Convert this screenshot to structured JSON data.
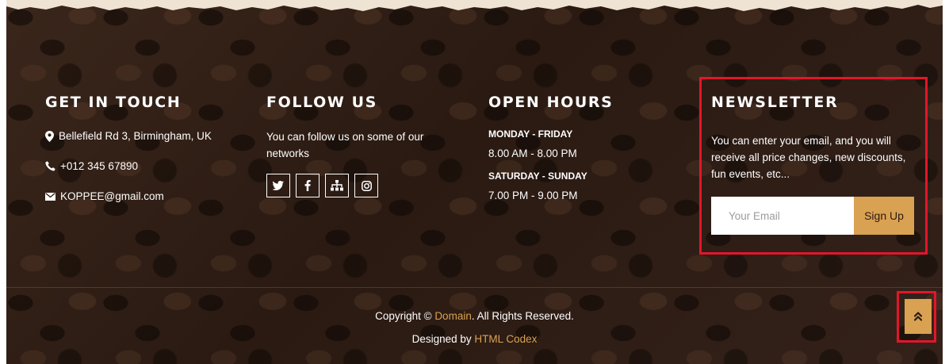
{
  "contact": {
    "title": "GET IN TOUCH",
    "address": "Bellefield Rd 3, Birmingham, UK",
    "phone": "+012 345 67890",
    "email": "KOPPEE@gmail.com",
    "icons": [
      "map-marker-icon",
      "phone-icon",
      "envelope-icon"
    ]
  },
  "follow": {
    "title": "FOLLOW US",
    "text": "You can follow us on some of our networks",
    "socials": [
      "twitter-icon",
      "facebook-icon",
      "sitemap-icon",
      "instagram-icon"
    ]
  },
  "hours": {
    "title": "OPEN HOURS",
    "weekday_label": "MONDAY - FRIDAY",
    "weekday_time": "8.00 AM - 8.00 PM",
    "weekend_label": "SATURDAY - SUNDAY",
    "weekend_time": "7.00 PM - 9.00 PM"
  },
  "newsletter": {
    "title": "NEWSLETTER",
    "text": "You can enter your email, and you will receive all price changes, new discounts, fun events, etc...",
    "placeholder": "Your Email",
    "button": "Sign Up"
  },
  "footer": {
    "copyright_prefix": "Copyright © ",
    "domain_link": "Domain",
    "copyright_suffix": ". All Rights Reserved.",
    "designed_prefix": "Designed by ",
    "designer_link": "HTML Codex"
  },
  "colors": {
    "accent": "#d9a152",
    "highlight_border": "#e3162a",
    "background": "#2e1d15"
  }
}
